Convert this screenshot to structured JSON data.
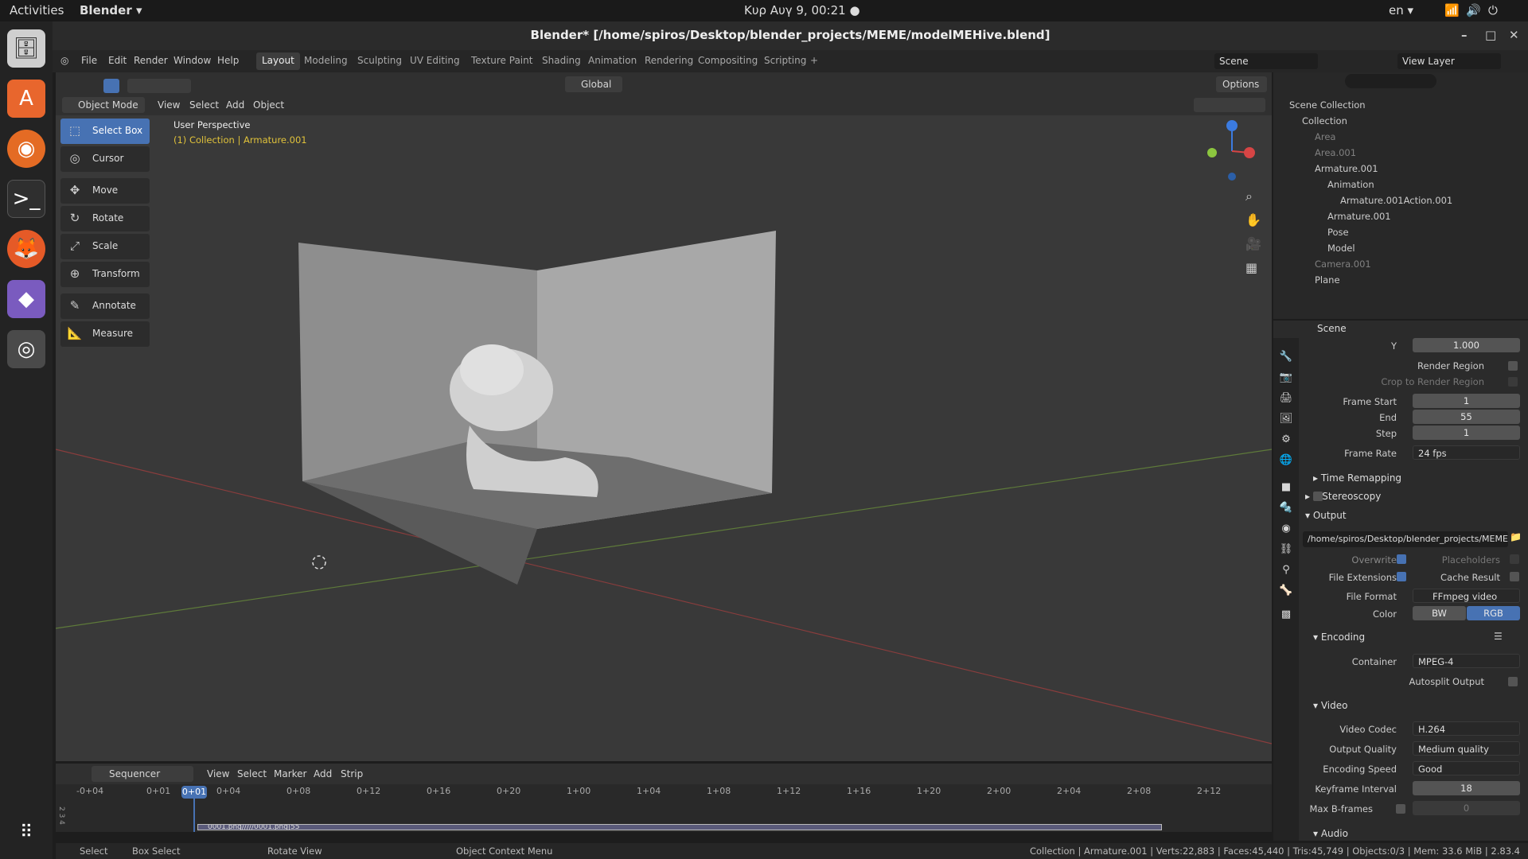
{
  "topbar": {
    "activities": "Activities",
    "app": "Blender ▾",
    "clock": "Κυρ Αυγ  9, 00:21 ●",
    "lang": "en ▾"
  },
  "window": {
    "title": "Blender* [/home/spiros/Desktop/blender_projects/MEME/modelMEHive.blend]"
  },
  "menu": [
    "File",
    "Edit",
    "Render",
    "Window",
    "Help"
  ],
  "workspaces": [
    "Layout",
    "Modeling",
    "Sculpting",
    "UV Editing",
    "Texture Paint",
    "Shading",
    "Animation",
    "Rendering",
    "Compositing",
    "Scripting"
  ],
  "scene": {
    "name": "Scene",
    "view_layer": "View Layer"
  },
  "viewport": {
    "mode": "Object Mode",
    "menus": [
      "View",
      "Select",
      "Add",
      "Object"
    ],
    "orientation": "Global",
    "options": "Options",
    "overlay1": "User Perspective",
    "overlay2": "(1) Collection | Armature.001"
  },
  "tools": [
    "Select Box",
    "Cursor",
    "Move",
    "Rotate",
    "Scale",
    "Transform",
    "Annotate",
    "Measure"
  ],
  "outliner": {
    "rows": [
      {
        "label": "Scene Collection",
        "indent": 0,
        "dim": false
      },
      {
        "label": "Collection",
        "indent": 1,
        "dim": false
      },
      {
        "label": "Area",
        "indent": 2,
        "dim": true
      },
      {
        "label": "Area.001",
        "indent": 2,
        "dim": true
      },
      {
        "label": "Armature.001",
        "indent": 2,
        "dim": false
      },
      {
        "label": "Animation",
        "indent": 3,
        "dim": false
      },
      {
        "label": "Armature.001Action.001",
        "indent": 4,
        "dim": false
      },
      {
        "label": "Armature.001",
        "indent": 3,
        "dim": false
      },
      {
        "label": "Pose",
        "indent": 3,
        "dim": false
      },
      {
        "label": "Model",
        "indent": 3,
        "dim": false
      },
      {
        "label": "Camera.001",
        "indent": 2,
        "dim": true
      },
      {
        "label": "Plane",
        "indent": 2,
        "dim": false
      }
    ]
  },
  "props": {
    "header": "Scene",
    "y_label": "Y",
    "y_value": "1.000",
    "render_region": "Render Region",
    "crop": "Crop to Render Region",
    "frame_start_label": "Frame Start",
    "frame_start": "1",
    "end_label": "End",
    "end": "55",
    "step_label": "Step",
    "step": "1",
    "frame_rate_label": "Frame Rate",
    "frame_rate": "24 fps",
    "time_remapping": "Time Remapping",
    "stereoscopy": "Stereoscopy",
    "output": "Output",
    "path": "/home/spiros/Desktop/blender_projects/MEME/",
    "overwrite": "Overwrite",
    "placeholders": "Placeholders",
    "file_ext": "File Extensions",
    "cache": "Cache Result",
    "file_format_label": "File Format",
    "file_format": "FFmpeg video",
    "color_label": "Color",
    "bw": "BW",
    "rgb": "RGB",
    "encoding": "Encoding",
    "container_label": "Container",
    "container": "MPEG-4",
    "autosplit": "Autosplit Output",
    "video": "Video",
    "codec_label": "Video Codec",
    "codec": "H.264",
    "quality_label": "Output Quality",
    "quality": "Medium quality",
    "speed_label": "Encoding Speed",
    "speed": "Good",
    "keyframe_label": "Keyframe Interval",
    "keyframe": "18",
    "bframes_label": "Max B-frames",
    "bframes": "0",
    "audio": "Audio"
  },
  "sequencer": {
    "editor": "Sequencer",
    "menus": [
      "View",
      "Select",
      "Marker",
      "Add",
      "Strip"
    ],
    "ticks": [
      "-0+04",
      "0+01",
      "0+04",
      "0+08",
      "0+12",
      "0+16",
      "0+20",
      "1+00",
      "1+04",
      "1+08",
      "1+12",
      "1+16",
      "1+20",
      "2+00",
      "2+04",
      "2+08",
      "2+12"
    ],
    "current": "0+01",
    "strip": "0001.png/////0001.png|55",
    "channels": "2 3 4"
  },
  "status": {
    "select": "Select",
    "box_select": "Box Select",
    "rotate": "Rotate View",
    "context": "Object Context Menu",
    "info": "Collection | Armature.001 | Verts:22,883 | Faces:45,440 | Tris:45,749 | Objects:0/3 | Mem: 33.6 MiB | 2.83.4"
  }
}
